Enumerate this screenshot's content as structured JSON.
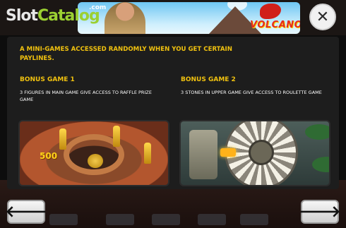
{
  "header": {
    "watermark": {
      "part1": "Slot",
      "part2": "Catalog",
      "suffix": ".com"
    },
    "logo_text": "VOLCANO",
    "close_label": "✕"
  },
  "info": {
    "intro": "A mini-games accessed randomly when you get certain paylines.",
    "bonus1": {
      "title": "BONUS GAME 1",
      "desc": "3 figures in main game give access to raffle prize game"
    },
    "bonus2": {
      "title": "BONUS GAME 2",
      "desc": "3 stones in upper game give access to roulette game"
    },
    "image1_value": "500"
  },
  "nav": {
    "prev_label": "🡐",
    "next_label": "🡒"
  },
  "colors": {
    "accent": "#f1c20f",
    "panel": "#1d1d1d"
  },
  "icons": {
    "close": "close-icon",
    "prev": "arrow-left-icon",
    "next": "arrow-right-icon"
  }
}
